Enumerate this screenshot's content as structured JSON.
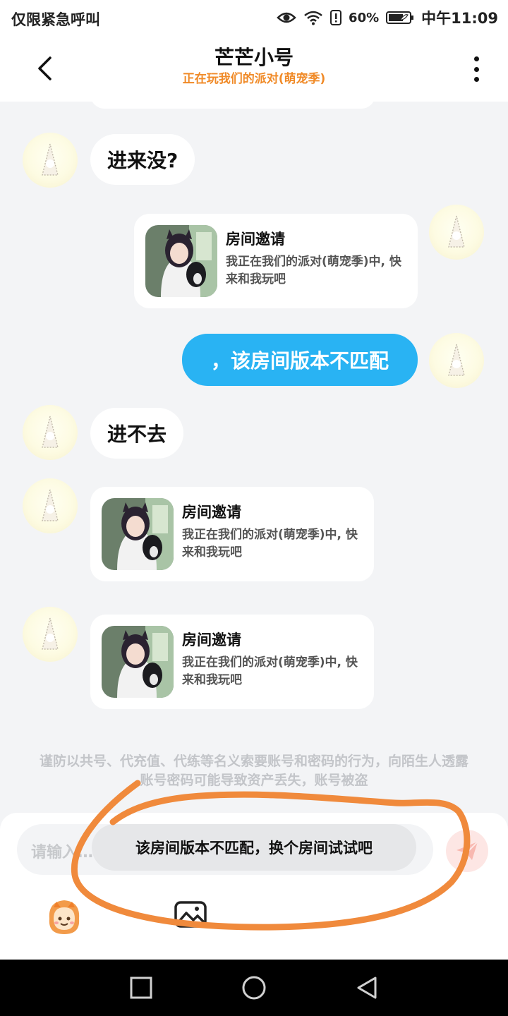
{
  "status_bar": {
    "left_text": "仅限紧急呼叫",
    "battery": "60%",
    "time": "中午11:09",
    "icons": [
      "eye-icon",
      "wifi-icon",
      "alert-icon",
      "battery-icon"
    ]
  },
  "header": {
    "title": "芒芒小号",
    "subtitle": "正在玩我们的派对(萌宠季)",
    "back_icon": "chevron-left-icon",
    "more_icon": "more-vertical-icon"
  },
  "messages": [
    {
      "side": "left",
      "type": "text",
      "text": "进来没?"
    },
    {
      "side": "right",
      "type": "card",
      "title": "房间邀请",
      "desc": "我正在我们的派对(萌宠季)中, 快来和我玩吧"
    },
    {
      "side": "right",
      "type": "text",
      "text": "，该房间版本不匹配"
    },
    {
      "side": "left",
      "type": "text",
      "text": "进不去"
    },
    {
      "side": "left",
      "type": "card",
      "title": "房间邀请",
      "desc": "我正在我们的派对(萌宠季)中, 快来和我玩吧"
    },
    {
      "side": "left",
      "type": "card",
      "title": "房间邀请",
      "desc": "我正在我们的派对(萌宠季)中, 快来和我玩吧"
    }
  ],
  "warning": "谨防以共号、代充值、代练等名义索要账号和密码的行为，向陌生人透露账号密码可能导致资产丢失，账号被盗",
  "input": {
    "placeholder": "请输入…",
    "send_icon": "send-icon",
    "emoji_icon": "mascot-emoji-icon",
    "image_icon": "image-icon"
  },
  "toast": "该房间版本不匹配，换个房间试试吧",
  "colors": {
    "accent": "#29b3f3",
    "subtitle": "#f08a27",
    "annotation": "#f08a3c"
  }
}
